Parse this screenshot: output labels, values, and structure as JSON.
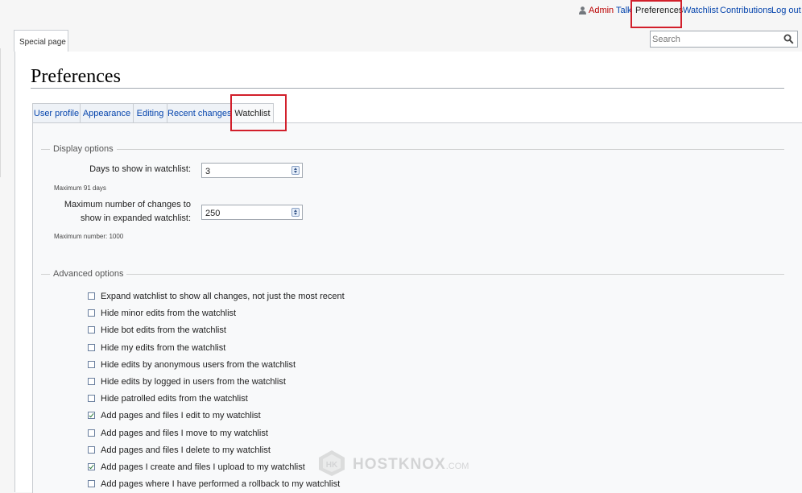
{
  "personal_bar": {
    "username": "Admin",
    "talk": "Talk",
    "preferences": "Preferences",
    "watchlist": "Watchlist",
    "contributions": "Contributions",
    "logout": "Log out"
  },
  "content_tab": "Special page",
  "search": {
    "placeholder": "Search"
  },
  "page_title": "Preferences",
  "tabs": [
    {
      "label": "User profile"
    },
    {
      "label": "Appearance"
    },
    {
      "label": "Editing"
    },
    {
      "label": "Recent changes"
    },
    {
      "label": "Watchlist",
      "active": true
    }
  ],
  "display_options": {
    "legend": "Display options",
    "days_label": "Days to show in watchlist:",
    "days_value": "3",
    "days_help": "Maximum 91 days",
    "max_changes_label_line1": "Maximum number of changes to",
    "max_changes_label_line2": "show in expanded watchlist:",
    "max_changes_value": "250",
    "max_changes_help": "Maximum number: 1000"
  },
  "advanced_options": {
    "legend": "Advanced options",
    "items": [
      {
        "label": "Expand watchlist to show all changes, not just the most recent",
        "checked": false
      },
      {
        "label": "Hide minor edits from the watchlist",
        "checked": false
      },
      {
        "label": "Hide bot edits from the watchlist",
        "checked": false
      },
      {
        "label": "Hide my edits from the watchlist",
        "checked": false
      },
      {
        "label": "Hide edits by anonymous users from the watchlist",
        "checked": false
      },
      {
        "label": "Hide edits by logged in users from the watchlist",
        "checked": false
      },
      {
        "label": "Hide patrolled edits from the watchlist",
        "checked": false
      },
      {
        "label": "Add pages and files I edit to my watchlist",
        "checked": true
      },
      {
        "label": "Add pages and files I move to my watchlist",
        "checked": false
      },
      {
        "label": "Add pages and files I delete to my watchlist",
        "checked": false
      },
      {
        "label": "Add pages I create and files I upload to my watchlist",
        "checked": true
      },
      {
        "label": "Add pages where I have performed a rollback to my watchlist",
        "checked": false
      }
    ]
  },
  "watermark": {
    "text": "HOSTKNOX",
    "suffix": ".COM"
  },
  "colors": {
    "link": "#0645ad",
    "highlight": "#d21f2b",
    "panel_bg": "#f8f9fa"
  }
}
